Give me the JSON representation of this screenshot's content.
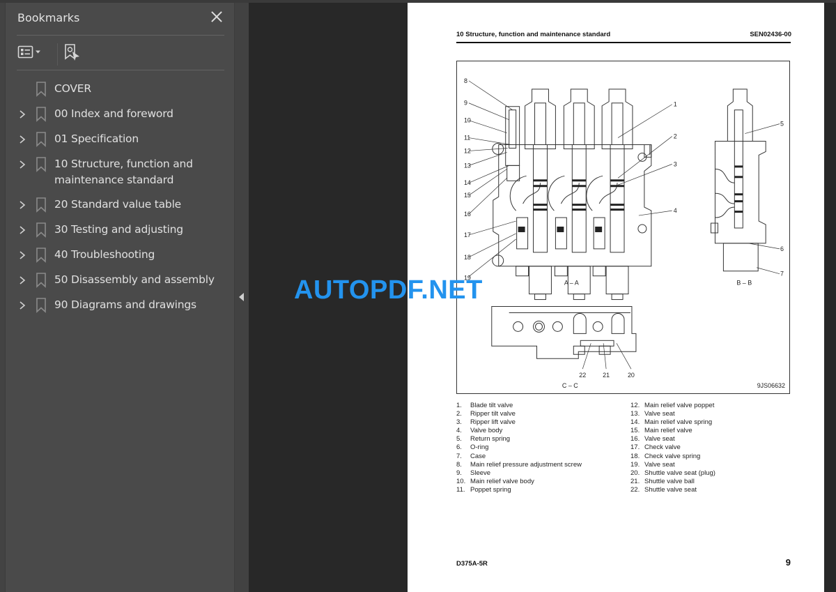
{
  "sidebar": {
    "title": "Bookmarks",
    "close_icon": "close-icon",
    "toolbar": {
      "options_icon": "list-options-icon",
      "find_icon": "find-current-bookmark-icon"
    },
    "items": [
      {
        "label": "COVER",
        "expandable": false
      },
      {
        "label": "00 Index and foreword",
        "expandable": true
      },
      {
        "label": "01 Specification",
        "expandable": true
      },
      {
        "label": "10 Structure, function and maintenance standard",
        "expandable": true
      },
      {
        "label": "20 Standard value table",
        "expandable": true
      },
      {
        "label": "30 Testing and adjusting",
        "expandable": true
      },
      {
        "label": "40 Troubleshooting",
        "expandable": true
      },
      {
        "label": "50 Disassembly and assembly",
        "expandable": true
      },
      {
        "label": "90 Diagrams and drawings",
        "expandable": true
      }
    ]
  },
  "collapse_panel_icon": "triangle-left-icon",
  "watermark": "AUTOPDF.NET",
  "page": {
    "header_left": "10 Structure, function and maintenance standard",
    "header_right": "SEN02436-00",
    "figure": {
      "section_aa": "A – A",
      "section_bb": "B – B",
      "section_cc": "C – C",
      "figure_code": "9JS06632",
      "callouts_aa_left": [
        "8",
        "9",
        "10",
        "11",
        "12",
        "13",
        "14",
        "15",
        "16",
        "17",
        "18",
        "19"
      ],
      "callouts_aa_right": [
        "1",
        "2",
        "3",
        "4"
      ],
      "callouts_bb": [
        "5",
        "6",
        "7"
      ],
      "callouts_cc": [
        "22",
        "21",
        "20"
      ]
    },
    "legend": [
      {
        "num": "1.",
        "text": "Blade tilt valve"
      },
      {
        "num": "2.",
        "text": "Ripper tilt valve"
      },
      {
        "num": "3.",
        "text": "Ripper lift valve"
      },
      {
        "num": "4.",
        "text": "Valve body"
      },
      {
        "num": "5.",
        "text": "Return spring"
      },
      {
        "num": "6.",
        "text": "O-ring"
      },
      {
        "num": "7.",
        "text": "Case"
      },
      {
        "num": "8.",
        "text": "Main relief pressure adjustment screw"
      },
      {
        "num": "9.",
        "text": "Sleeve"
      },
      {
        "num": "10.",
        "text": "Main relief valve body"
      },
      {
        "num": "11.",
        "text": "Poppet spring"
      },
      {
        "num": "12.",
        "text": "Main relief valve poppet"
      },
      {
        "num": "13.",
        "text": "Valve seat"
      },
      {
        "num": "14.",
        "text": "Main relief valve spring"
      },
      {
        "num": "15.",
        "text": "Main relief valve"
      },
      {
        "num": "16.",
        "text": "Valve seat"
      },
      {
        "num": "17.",
        "text": "Check valve"
      },
      {
        "num": "18.",
        "text": "Check valve spring"
      },
      {
        "num": "19.",
        "text": "Valve seat"
      },
      {
        "num": "20.",
        "text": "Shuttle valve seat (plug)"
      },
      {
        "num": "21.",
        "text": "Shuttle valve ball"
      },
      {
        "num": "22.",
        "text": "Shuttle valve seat"
      }
    ],
    "footer_left": "D375A-5R",
    "page_number": "9"
  }
}
